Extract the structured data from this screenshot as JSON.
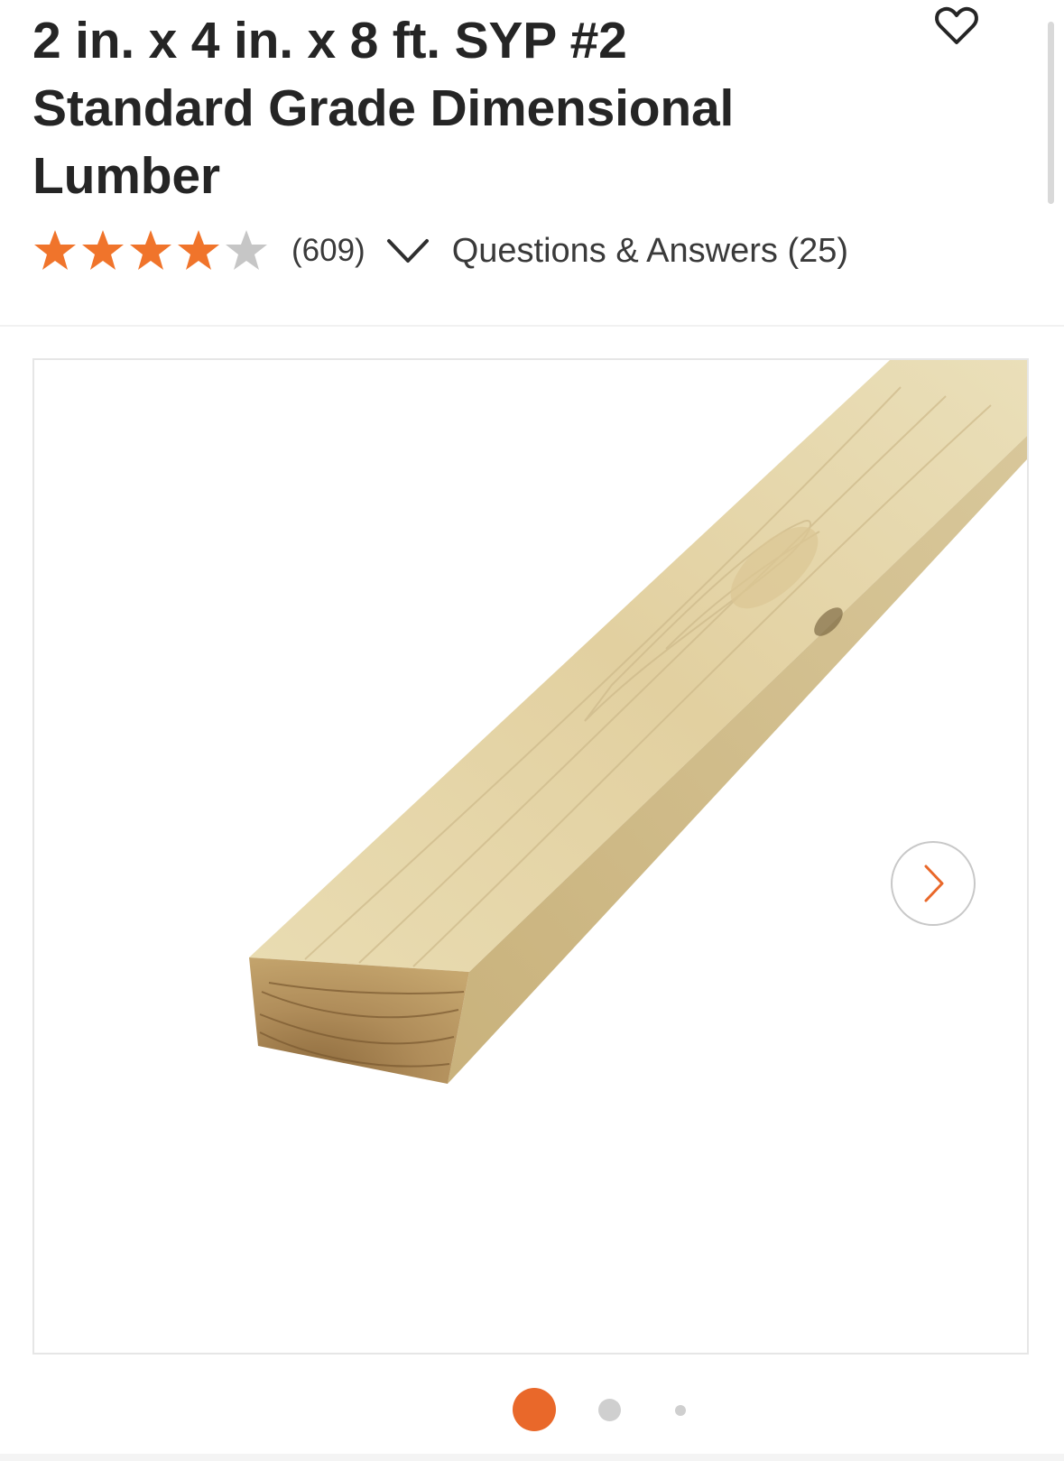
{
  "product": {
    "title": "2 in. x 4 in. x 8 ft. SYP #2 Standard Grade Dimensional Lumber",
    "rating": 4,
    "rating_max": 5,
    "review_count": "(609)",
    "qa_link": "Questions & Answers (25)"
  },
  "icons": {
    "favorite": "heart-outline-icon",
    "expand_reviews": "chevron-down-icon",
    "next_image": "chevron-right-icon"
  },
  "gallery": {
    "image_alt": "2x4 lumber board",
    "current_slide": 1,
    "slide_count": 3
  },
  "colors": {
    "accent": "#e9682a",
    "star_filled": "#f0742b",
    "star_empty": "#c6c6c6",
    "text": "#252525"
  }
}
